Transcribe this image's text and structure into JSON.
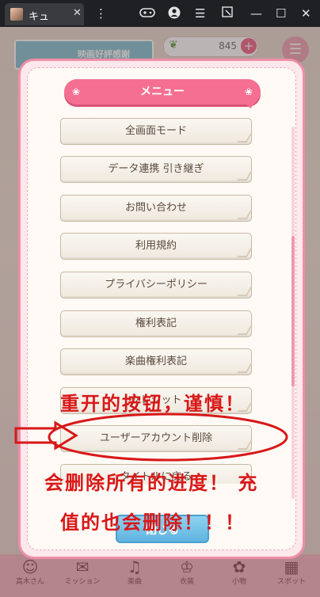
{
  "window": {
    "tab_title": "キュ",
    "tab_close": "✕",
    "controls": {
      "more": "⋮",
      "gamepad": "gamepad-icon",
      "account": "account-icon",
      "menu": "☰",
      "resize": "resize-icon",
      "minimize": "—",
      "maximize": "☐",
      "close": "✕"
    }
  },
  "game": {
    "banner_text": "映画好評感謝",
    "coins": "845",
    "coin_plus": "+",
    "bottom_nav": [
      {
        "icon": "☺",
        "label": "高木さん"
      },
      {
        "icon": "✉",
        "label": "ミッション"
      },
      {
        "icon": "♫",
        "label": "楽曲"
      },
      {
        "icon": "♔",
        "label": "衣装"
      },
      {
        "icon": "✿",
        "label": "小物"
      },
      {
        "icon": "▦",
        "label": "スポット"
      }
    ]
  },
  "menu": {
    "title": "メニュー",
    "items": [
      "全画面モード",
      "データ連携 引き継ぎ",
      "お問い合わせ",
      "利用規約",
      "プライバシーポリシー",
      "権利表記",
      "楽曲権利表記",
      "クレジット",
      "ユーザーアカウント削除",
      "タイトルに戻る"
    ],
    "close_label": "閉じる"
  },
  "annotation": {
    "line1": "重开的按钮，谨慎！",
    "line2": "会删除所有的进度！ 充",
    "line3": "值的也会删除！！！",
    "color": "#d81818"
  }
}
